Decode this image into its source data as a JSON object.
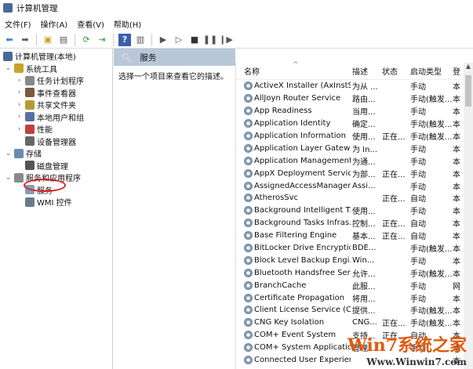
{
  "window": {
    "title": "计算机管理"
  },
  "menu": [
    "文件(F)",
    "操作(A)",
    "查看(V)",
    "帮助(H)"
  ],
  "tree": [
    {
      "label": "计算机管理(本地)",
      "level": 0,
      "arrow": ""
    },
    {
      "label": "系统工具",
      "level": 1,
      "arrow": "⌄"
    },
    {
      "label": "任务计划程序",
      "level": 2,
      "arrow": "›"
    },
    {
      "label": "事件查看器",
      "level": 2,
      "arrow": "›"
    },
    {
      "label": "共享文件夹",
      "level": 2,
      "arrow": "›"
    },
    {
      "label": "本地用户和组",
      "level": 2,
      "arrow": "›"
    },
    {
      "label": "性能",
      "level": 2,
      "arrow": "›"
    },
    {
      "label": "设备管理器",
      "level": 2,
      "arrow": ""
    },
    {
      "label": "存储",
      "level": 1,
      "arrow": "⌄"
    },
    {
      "label": "磁盘管理",
      "level": 2,
      "arrow": ""
    },
    {
      "label": "服务和应用程序",
      "level": 1,
      "arrow": "⌄"
    },
    {
      "label": "服务",
      "level": 2,
      "arrow": ""
    },
    {
      "label": "WMI 控件",
      "level": 2,
      "arrow": ""
    }
  ],
  "middle": {
    "title": "服务",
    "description": "选择一个项目来查看它的描述。"
  },
  "columns": [
    "名称",
    "描述",
    "状态",
    "启动类型",
    "登"
  ],
  "services": [
    [
      "ActiveX Installer (AxInstSV)",
      "为从 ...",
      "",
      "手动",
      "本"
    ],
    [
      "AllJoyn Router Service",
      "路由...",
      "",
      "手动(触发...",
      "本"
    ],
    [
      "App Readiness",
      "当用...",
      "",
      "手动",
      "本"
    ],
    [
      "Application Identity",
      "确定...",
      "",
      "手动(触发...",
      "本"
    ],
    [
      "Application Information",
      "使用...",
      "正在...",
      "手动(触发...",
      "本"
    ],
    [
      "Application Layer Gatewa...",
      "为 In...",
      "",
      "手动",
      "本"
    ],
    [
      "Application Management",
      "为通...",
      "",
      "手动",
      "本"
    ],
    [
      "AppX Deployment Servic...",
      "为部...",
      "正在...",
      "手动",
      "本"
    ],
    [
      "AssignedAccessManager...",
      "Assi...",
      "",
      "手动",
      "本"
    ],
    [
      "AtherosSvc",
      "",
      "正在...",
      "自动",
      "本"
    ],
    [
      "Background Intelligent T...",
      "使用...",
      "",
      "手动",
      "本"
    ],
    [
      "Background Tasks Infras...",
      "控制...",
      "正在...",
      "自动",
      "本"
    ],
    [
      "Base Filtering Engine",
      "基本...",
      "正在...",
      "自动",
      "本"
    ],
    [
      "BitLocker Drive Encryptio...",
      "BDE...",
      "",
      "手动(触发...",
      "本"
    ],
    [
      "Block Level Backup Engi...",
      "Win...",
      "",
      "手动",
      "本"
    ],
    [
      "Bluetooth Handsfree Ser...",
      "允许...",
      "",
      "手动(触发...",
      "本"
    ],
    [
      "BranchCache",
      "此服...",
      "",
      "手动",
      "网"
    ],
    [
      "Certificate Propagation",
      "将用...",
      "",
      "手动",
      "本"
    ],
    [
      "Client License Service (Cli...",
      "提供...",
      "",
      "手动(触发...",
      "本"
    ],
    [
      "CNG Key Isolation",
      "CNG...",
      "正在...",
      "手动(触发...",
      "本"
    ],
    [
      "COM+ Event System",
      "支持...",
      "正在...",
      "自动",
      "本"
    ],
    [
      "COM+ System Application",
      "管理...",
      "",
      "手动",
      "本"
    ],
    [
      "Connected User Experien...",
      "",
      "",
      "",
      "本"
    ]
  ],
  "watermark": {
    "line1": "Win7系统之家",
    "line2": "Www.Winwin7.com"
  }
}
